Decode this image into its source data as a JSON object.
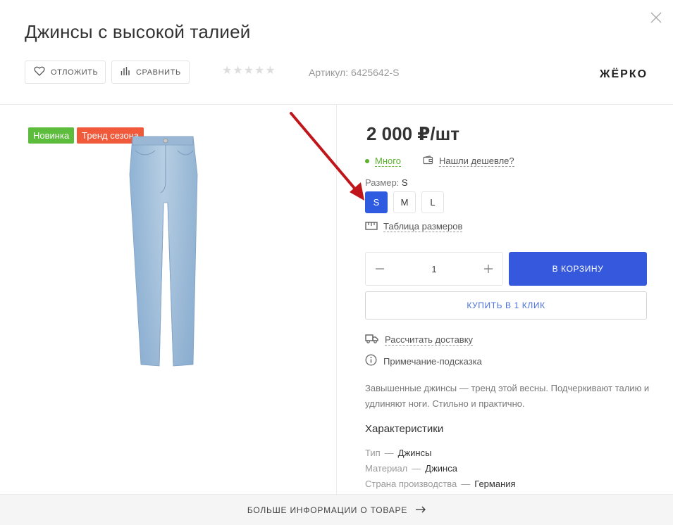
{
  "product": {
    "title": "Джинсы с высокой талией",
    "rating": {
      "value": 0,
      "max": 5
    },
    "sku_label": "Артикул:",
    "sku": "6425642-S",
    "brand": "ЖЁРКО",
    "badges": [
      "Новинка",
      "Тренд сезона"
    ],
    "price": "2 000 ₽/шт",
    "stock": "Много",
    "cheaper_link": "Нашли дешевле?",
    "size_label": "Размер:",
    "selected_size": "S",
    "sizes": [
      "S",
      "M",
      "L"
    ],
    "size_table_link": "Таблица размеров",
    "quantity": "1",
    "cart_button": "В КОРЗИНУ",
    "one_click_button": "КУПИТЬ В 1 КЛИК",
    "delivery_link": "Рассчитать доставку",
    "hint": "Примечание-подсказка",
    "description": "Завышенные джинсы — тренд этой весны. Подчеркивают талию и удлиняют ноги. Стильно и практично.",
    "characteristics_title": "Характеристики",
    "characteristics": [
      {
        "name": "Тип",
        "value": "Джинсы"
      },
      {
        "name": "Материал",
        "value": "Джинса"
      },
      {
        "name": "Страна производства",
        "value": "Германия"
      }
    ]
  },
  "toolbar": {
    "favorite_label": "ОТЛОЖИТЬ",
    "compare_label": "СРАВНИТЬ"
  },
  "footer": {
    "more_info_label": "БОЛЬШЕ ИНФОРМАЦИИ О ТОВАРЕ"
  },
  "colors": {
    "accent": "#3558dc",
    "badge_new": "#5cbd3c",
    "badge_trend": "#f05a3a",
    "stock_green": "#5cb22b",
    "annotation_arrow": "#c0161b"
  }
}
